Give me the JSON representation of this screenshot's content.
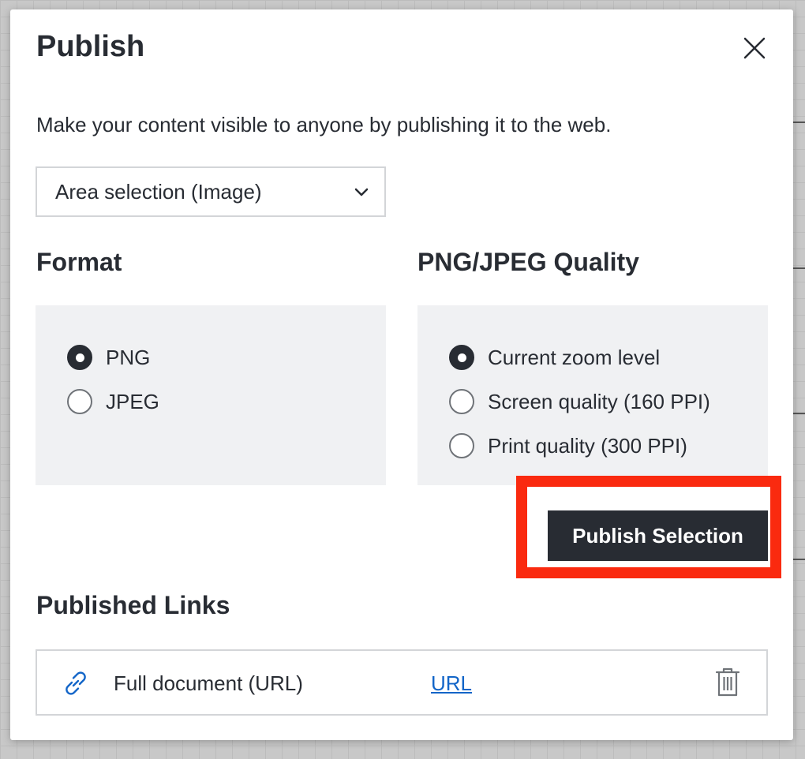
{
  "dialog": {
    "title": "Publish",
    "description": "Make your content visible to anyone by publishing it to the web.",
    "close_icon": "close-icon"
  },
  "scope_select": {
    "value": "Area selection (Image)",
    "icon": "chevron-down-icon"
  },
  "format": {
    "heading": "Format",
    "options": [
      {
        "label": "PNG",
        "checked": true
      },
      {
        "label": "JPEG",
        "checked": false
      }
    ]
  },
  "quality": {
    "heading": "PNG/JPEG Quality",
    "options": [
      {
        "label": "Current zoom level",
        "checked": true
      },
      {
        "label": "Screen quality (160 PPI)",
        "checked": false
      },
      {
        "label": "Print quality (300 PPI)",
        "checked": false
      }
    ]
  },
  "publish_button": {
    "label": "Publish Selection"
  },
  "published_links": {
    "heading": "Published Links",
    "rows": [
      {
        "icon": "link-icon",
        "name": "Full document (URL)",
        "url_label": "URL",
        "action_icon": "trash-icon"
      }
    ]
  },
  "colors": {
    "primary_dark": "#282c33",
    "highlight": "#fa2a0f",
    "link": "#1265c8",
    "panel_bg": "#f0f1f3"
  }
}
